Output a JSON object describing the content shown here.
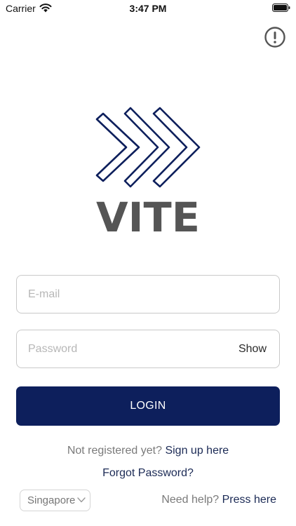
{
  "status_bar": {
    "carrier": "Carrier",
    "time": "3:47 PM"
  },
  "icons": {
    "info": "exclamation-circle-icon",
    "wifi": "wifi-icon",
    "battery": "battery-icon",
    "chevron": "chevron-down-icon"
  },
  "brand": {
    "name": "VITE",
    "primary_color": "#0d1f5c",
    "text_color": "#555555"
  },
  "login_form": {
    "email_placeholder": "E-mail",
    "password_placeholder": "Password",
    "show_label": "Show",
    "login_label": "LOGIN"
  },
  "signup": {
    "prompt": "Not registered yet?",
    "link": "Sign up here"
  },
  "forgot_password": "Forgot Password?",
  "footer": {
    "region": "Singapore",
    "help_prompt": "Need help?",
    "help_link": "Press here"
  }
}
